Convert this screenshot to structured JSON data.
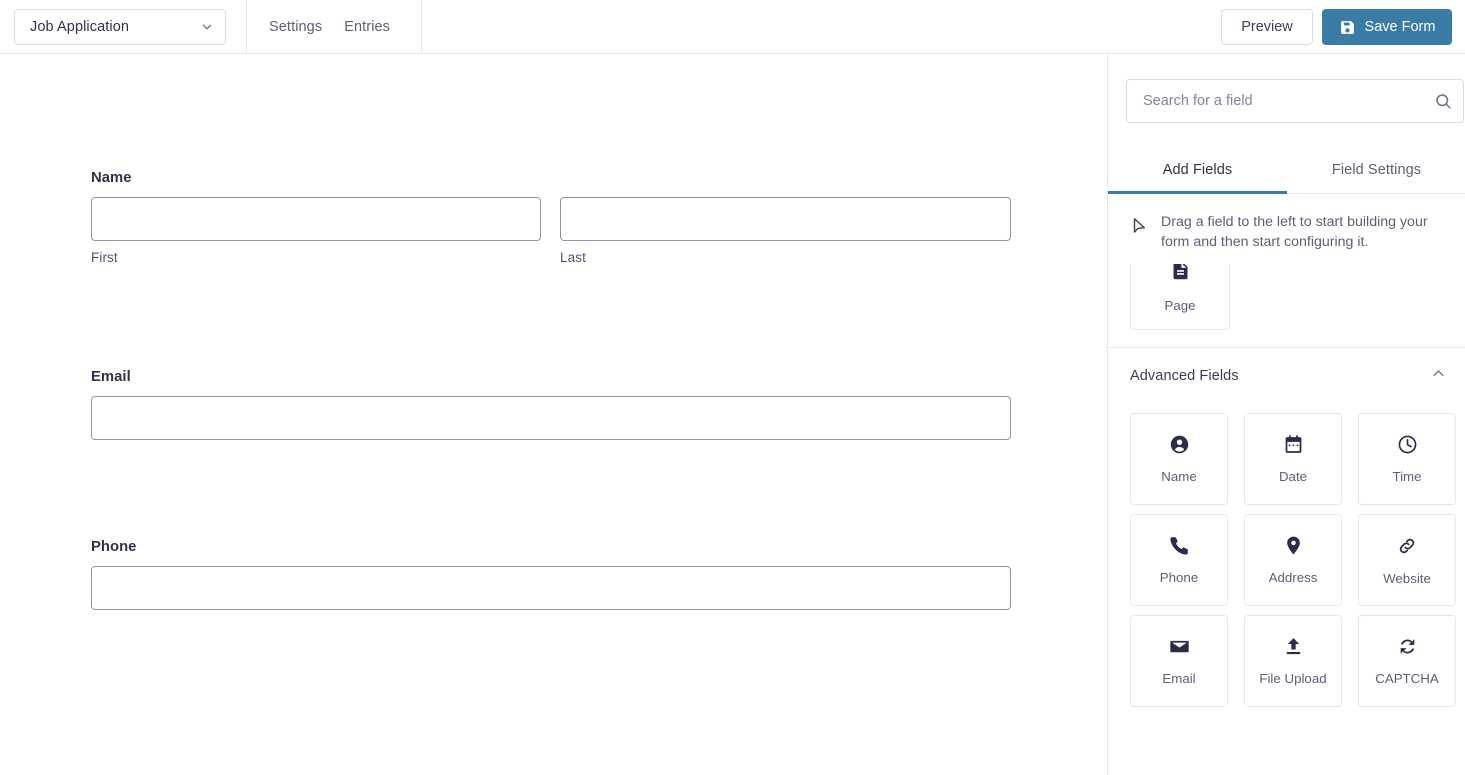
{
  "topbar": {
    "form_select": {
      "value": "Job Application",
      "chevron_icon": "chevron-down-icon"
    },
    "nav": [
      {
        "label": "Settings"
      },
      {
        "label": "Entries"
      }
    ],
    "preview_label": "Preview",
    "save_label": "Save Form",
    "save_icon": "floppy-disk-icon",
    "accent_color": "#3a7ca5"
  },
  "canvas": {
    "fields": [
      {
        "label": "Name",
        "type": "name",
        "inputs": [
          {
            "value": "",
            "placeholder": "",
            "sublabel": "First"
          },
          {
            "value": "",
            "placeholder": "",
            "sublabel": "Last"
          }
        ]
      },
      {
        "label": "Email",
        "type": "email",
        "inputs": [
          {
            "value": "",
            "placeholder": "",
            "sublabel": ""
          }
        ]
      },
      {
        "label": "Phone",
        "type": "phone",
        "inputs": [
          {
            "value": "",
            "placeholder": "",
            "sublabel": ""
          }
        ]
      }
    ]
  },
  "sidebar": {
    "search": {
      "value": "",
      "placeholder": "Search for a field",
      "icon": "search-icon"
    },
    "tabs": [
      {
        "label": "Add Fields",
        "active": true
      },
      {
        "label": "Field Settings",
        "active": false
      }
    ],
    "hint": {
      "icon": "cursor-arrow-icon",
      "text": "Drag a field to the left to start building your form and then start configuring it."
    },
    "partial_card": {
      "label": "Page",
      "icon": "page-document-icon"
    },
    "sections": [
      {
        "title": "Advanced Fields",
        "collapse_icon": "chevron-up-icon",
        "expanded": true,
        "cards": [
          {
            "label": "Name",
            "icon": "person-circle-icon"
          },
          {
            "label": "Date",
            "icon": "calendar-icon"
          },
          {
            "label": "Time",
            "icon": "clock-icon"
          },
          {
            "label": "Phone",
            "icon": "phone-icon"
          },
          {
            "label": "Address",
            "icon": "map-pin-icon"
          },
          {
            "label": "Website",
            "icon": "link-icon"
          },
          {
            "label": "Email",
            "icon": "envelope-icon"
          },
          {
            "label": "File Upload",
            "icon": "upload-icon"
          },
          {
            "label": "CAPTCHA",
            "icon": "refresh-captcha-icon"
          }
        ]
      }
    ]
  }
}
